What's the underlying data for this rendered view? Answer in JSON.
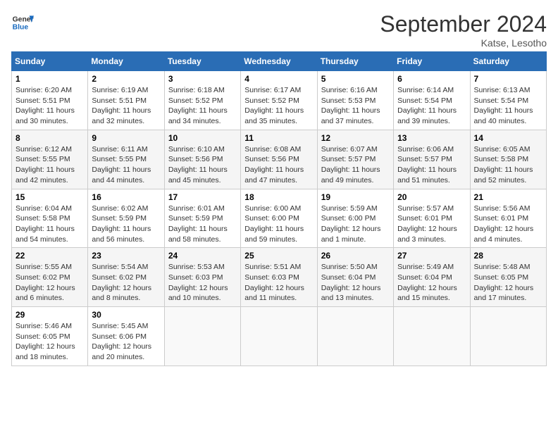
{
  "header": {
    "logo_general": "General",
    "logo_blue": "Blue",
    "month_year": "September 2024",
    "location": "Katse, Lesotho"
  },
  "days_of_week": [
    "Sunday",
    "Monday",
    "Tuesday",
    "Wednesday",
    "Thursday",
    "Friday",
    "Saturday"
  ],
  "weeks": [
    [
      {
        "day": "1",
        "sunrise": "6:20 AM",
        "sunset": "5:51 PM",
        "daylight": "11 hours and 30 minutes."
      },
      {
        "day": "2",
        "sunrise": "6:19 AM",
        "sunset": "5:51 PM",
        "daylight": "11 hours and 32 minutes."
      },
      {
        "day": "3",
        "sunrise": "6:18 AM",
        "sunset": "5:52 PM",
        "daylight": "11 hours and 34 minutes."
      },
      {
        "day": "4",
        "sunrise": "6:17 AM",
        "sunset": "5:52 PM",
        "daylight": "11 hours and 35 minutes."
      },
      {
        "day": "5",
        "sunrise": "6:16 AM",
        "sunset": "5:53 PM",
        "daylight": "11 hours and 37 minutes."
      },
      {
        "day": "6",
        "sunrise": "6:14 AM",
        "sunset": "5:54 PM",
        "daylight": "11 hours and 39 minutes."
      },
      {
        "day": "7",
        "sunrise": "6:13 AM",
        "sunset": "5:54 PM",
        "daylight": "11 hours and 40 minutes."
      }
    ],
    [
      {
        "day": "8",
        "sunrise": "6:12 AM",
        "sunset": "5:55 PM",
        "daylight": "11 hours and 42 minutes."
      },
      {
        "day": "9",
        "sunrise": "6:11 AM",
        "sunset": "5:55 PM",
        "daylight": "11 hours and 44 minutes."
      },
      {
        "day": "10",
        "sunrise": "6:10 AM",
        "sunset": "5:56 PM",
        "daylight": "11 hours and 45 minutes."
      },
      {
        "day": "11",
        "sunrise": "6:08 AM",
        "sunset": "5:56 PM",
        "daylight": "11 hours and 47 minutes."
      },
      {
        "day": "12",
        "sunrise": "6:07 AM",
        "sunset": "5:57 PM",
        "daylight": "11 hours and 49 minutes."
      },
      {
        "day": "13",
        "sunrise": "6:06 AM",
        "sunset": "5:57 PM",
        "daylight": "11 hours and 51 minutes."
      },
      {
        "day": "14",
        "sunrise": "6:05 AM",
        "sunset": "5:58 PM",
        "daylight": "11 hours and 52 minutes."
      }
    ],
    [
      {
        "day": "15",
        "sunrise": "6:04 AM",
        "sunset": "5:58 PM",
        "daylight": "11 hours and 54 minutes."
      },
      {
        "day": "16",
        "sunrise": "6:02 AM",
        "sunset": "5:59 PM",
        "daylight": "11 hours and 56 minutes."
      },
      {
        "day": "17",
        "sunrise": "6:01 AM",
        "sunset": "5:59 PM",
        "daylight": "11 hours and 58 minutes."
      },
      {
        "day": "18",
        "sunrise": "6:00 AM",
        "sunset": "6:00 PM",
        "daylight": "11 hours and 59 minutes."
      },
      {
        "day": "19",
        "sunrise": "5:59 AM",
        "sunset": "6:00 PM",
        "daylight": "12 hours and 1 minute."
      },
      {
        "day": "20",
        "sunrise": "5:57 AM",
        "sunset": "6:01 PM",
        "daylight": "12 hours and 3 minutes."
      },
      {
        "day": "21",
        "sunrise": "5:56 AM",
        "sunset": "6:01 PM",
        "daylight": "12 hours and 4 minutes."
      }
    ],
    [
      {
        "day": "22",
        "sunrise": "5:55 AM",
        "sunset": "6:02 PM",
        "daylight": "12 hours and 6 minutes."
      },
      {
        "day": "23",
        "sunrise": "5:54 AM",
        "sunset": "6:02 PM",
        "daylight": "12 hours and 8 minutes."
      },
      {
        "day": "24",
        "sunrise": "5:53 AM",
        "sunset": "6:03 PM",
        "daylight": "12 hours and 10 minutes."
      },
      {
        "day": "25",
        "sunrise": "5:51 AM",
        "sunset": "6:03 PM",
        "daylight": "12 hours and 11 minutes."
      },
      {
        "day": "26",
        "sunrise": "5:50 AM",
        "sunset": "6:04 PM",
        "daylight": "12 hours and 13 minutes."
      },
      {
        "day": "27",
        "sunrise": "5:49 AM",
        "sunset": "6:04 PM",
        "daylight": "12 hours and 15 minutes."
      },
      {
        "day": "28",
        "sunrise": "5:48 AM",
        "sunset": "6:05 PM",
        "daylight": "12 hours and 17 minutes."
      }
    ],
    [
      {
        "day": "29",
        "sunrise": "5:46 AM",
        "sunset": "6:05 PM",
        "daylight": "12 hours and 18 minutes."
      },
      {
        "day": "30",
        "sunrise": "5:45 AM",
        "sunset": "6:06 PM",
        "daylight": "12 hours and 20 minutes."
      },
      null,
      null,
      null,
      null,
      null
    ]
  ],
  "labels": {
    "sunrise": "Sunrise:",
    "sunset": "Sunset:",
    "daylight": "Daylight:"
  }
}
